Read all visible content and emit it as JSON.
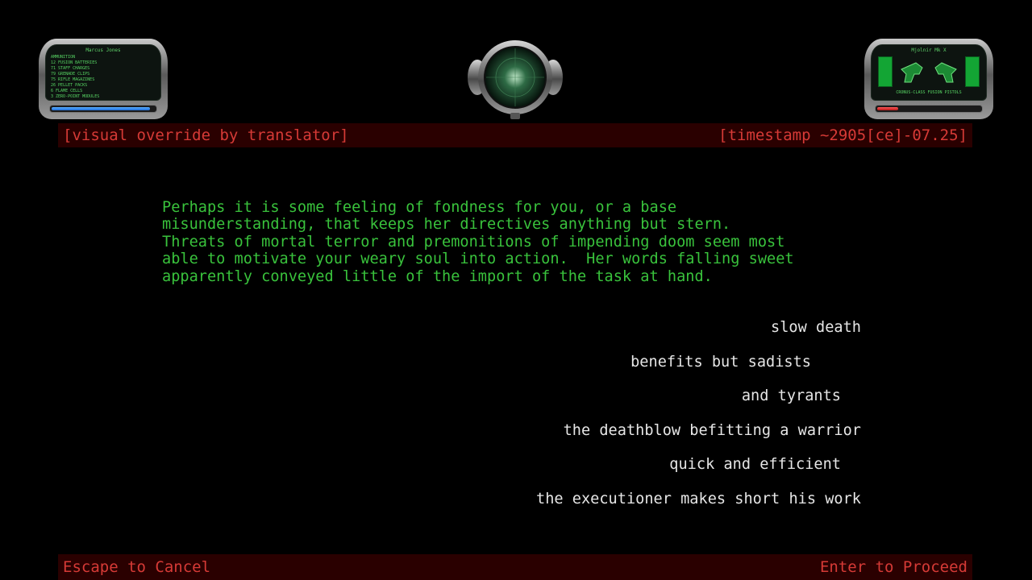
{
  "left_hud": {
    "player_name": "Marcus Jones",
    "ammo_title": "AMMUNITION",
    "ammo": [
      {
        "count": "12",
        "label": "FUSION BATTERIES"
      },
      {
        "count": "71",
        "label": "STAFF CHARGES"
      },
      {
        "count": "79",
        "label": "GRENADE CLIPS"
      },
      {
        "count": "75",
        "label": "RIFLE MAGAZINES"
      },
      {
        "count": "26",
        "label": "PELLET PACKS"
      },
      {
        "count": "6",
        "label": "FLAME CELLS"
      },
      {
        "count": "3",
        "label": "ZERO-POINT MODULES"
      }
    ],
    "shield_level": 0.95
  },
  "right_hud": {
    "armor_name": "Mjolnir Mk X",
    "weapon_name": "CRONUS-CLASS FUSION PISTOLS",
    "health_level": 0.2
  },
  "header": {
    "left_text": "[visual override by translator]",
    "right_text": "[timestamp ~2905[ce]-07.25]"
  },
  "narrative": {
    "lines": [
      "Perhaps it is some feeling of fondness for you, or a base",
      "misunderstanding, that keeps her directives anything but stern.",
      "Threats of mortal terror and premonitions of impending doom seem most",
      "able to motivate your weary soul into action.  Her words falling sweet",
      "apparently conveyed little of the import of the task at hand."
    ]
  },
  "choices": [
    "slow death",
    "benefits but sadists",
    "and tyrants",
    "the deathblow befitting a warrior",
    "quick and efficient",
    "the executioner makes short his work"
  ],
  "footer": {
    "cancel_text": "Escape to Cancel",
    "proceed_text": "Enter to Proceed"
  },
  "colors": {
    "narrative_green": "#39c23c",
    "bar_red_text": "#d63a36",
    "bar_background": "#2a0000",
    "choice_text": "#e6e6e6"
  }
}
